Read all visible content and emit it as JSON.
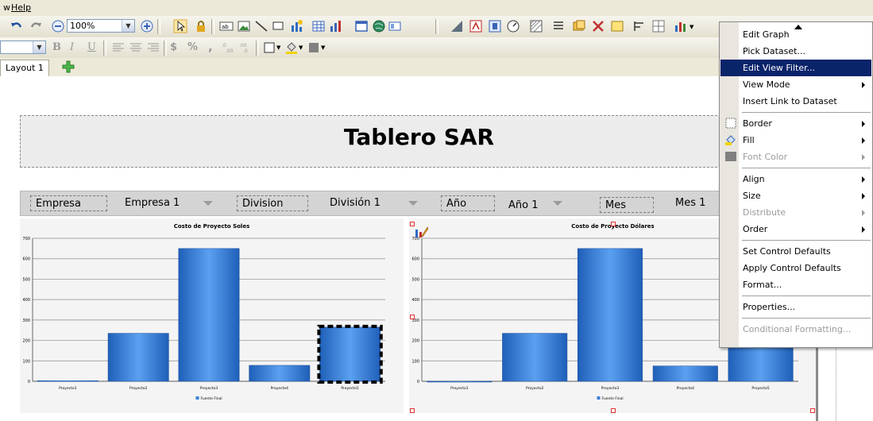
{
  "menubar": {
    "items": [
      "w",
      "Help"
    ]
  },
  "toolbar": {
    "zoom_value": "100%",
    "font_size_value": "",
    "bold_label": "B",
    "italic_label": "I",
    "underline_label": "U",
    "currency_label": "$",
    "percent_label": "%",
    "comma_label": ","
  },
  "tabs": {
    "active": "Layout 1"
  },
  "dashboard": {
    "title": "Tablero SAR",
    "filters": [
      {
        "label": "Empresa",
        "value": "Empresa 1"
      },
      {
        "label": "Division",
        "value": "División 1"
      },
      {
        "label": "Año",
        "value": "Año 1"
      },
      {
        "label": "Mes",
        "value": "Mes 1"
      }
    ]
  },
  "chart_data": [
    {
      "type": "bar",
      "title": "Costo de Proyecto Soles",
      "categories": [
        "Proyecto1",
        "Proyecto2",
        "Proyecto3",
        "Proyecto4",
        "Proyecto5"
      ],
      "series": [
        {
          "name": "Fuente Final",
          "values": [
            3,
            235,
            650,
            78,
            265
          ]
        }
      ],
      "ylim": [
        0,
        700
      ],
      "yticks": [
        "0",
        "100",
        "200",
        "300",
        "400",
        "500",
        "600",
        "700"
      ],
      "grid": true,
      "legend": "bottom",
      "bar_color": "#3a7fd6"
    },
    {
      "type": "bar",
      "title": "Costo de Proyecto Dólares",
      "categories": [
        "Proyecto1",
        "Proyecto2",
        "Proyecto3",
        "Proyecto4",
        "Proyecto5"
      ],
      "series": [
        {
          "name": "Fuente Final",
          "values": [
            0,
            235,
            650,
            75,
            268
          ]
        }
      ],
      "ylim": [
        0,
        700
      ],
      "yticks": [
        "0",
        "100",
        "200",
        "300",
        "400",
        "500",
        "600",
        "700"
      ],
      "grid": true,
      "legend": "bottom",
      "bar_color": "#3a7fd6"
    }
  ],
  "context_menu": {
    "items": [
      {
        "label": "Edit Graph",
        "submenu": false,
        "disabled": false,
        "highlighted": false,
        "icon": ""
      },
      {
        "label": "Pick Dataset...",
        "submenu": false,
        "disabled": false,
        "highlighted": false,
        "icon": ""
      },
      {
        "label": "Edit View Filter...",
        "submenu": false,
        "disabled": false,
        "highlighted": true,
        "icon": ""
      },
      {
        "label": "View Mode",
        "submenu": true,
        "disabled": false,
        "highlighted": false,
        "icon": ""
      },
      {
        "label": "Insert Link to Dataset",
        "submenu": false,
        "disabled": false,
        "highlighted": false,
        "icon": ""
      },
      {
        "sep": true
      },
      {
        "label": "Border",
        "submenu": true,
        "disabled": false,
        "highlighted": false,
        "icon": "border-icon"
      },
      {
        "label": "Fill",
        "submenu": true,
        "disabled": false,
        "highlighted": false,
        "icon": "fill-bucket-icon"
      },
      {
        "label": "Font Color",
        "submenu": true,
        "disabled": true,
        "highlighted": false,
        "icon": "font-color-icon"
      },
      {
        "sep": true
      },
      {
        "label": "Align",
        "submenu": true,
        "disabled": false,
        "highlighted": false,
        "icon": ""
      },
      {
        "label": "Size",
        "submenu": true,
        "disabled": false,
        "highlighted": false,
        "icon": ""
      },
      {
        "label": "Distribute",
        "submenu": true,
        "disabled": true,
        "highlighted": false,
        "icon": ""
      },
      {
        "label": "Order",
        "submenu": true,
        "disabled": false,
        "highlighted": false,
        "icon": ""
      },
      {
        "sep": true
      },
      {
        "label": "Set Control Defaults",
        "submenu": false,
        "disabled": false,
        "highlighted": false,
        "icon": ""
      },
      {
        "label": "Apply Control Defaults",
        "submenu": false,
        "disabled": false,
        "highlighted": false,
        "icon": ""
      },
      {
        "label": "Format...",
        "submenu": false,
        "disabled": false,
        "highlighted": false,
        "icon": ""
      },
      {
        "sep": true
      },
      {
        "label": "Properties...",
        "submenu": false,
        "disabled": false,
        "highlighted": false,
        "icon": ""
      },
      {
        "sep": true
      },
      {
        "label": "Conditional Formatting...",
        "submenu": false,
        "disabled": true,
        "highlighted": false,
        "icon": ""
      }
    ]
  }
}
